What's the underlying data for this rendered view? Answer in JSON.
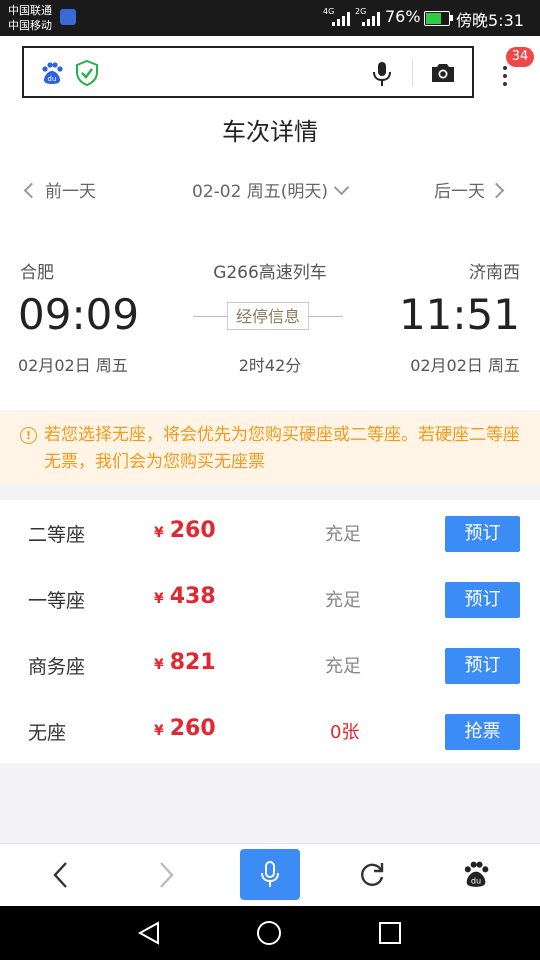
{
  "status_bar": {
    "carrier1": "中国联通",
    "carrier2": "中国移动",
    "net1": "4G",
    "net2": "2G",
    "battery": "76%",
    "battery_level": 0.76,
    "time": "傍晚5:31"
  },
  "browser": {
    "tab_count": "34"
  },
  "page": {
    "title": "车次详情",
    "prev_day": "前一天",
    "date": "02-02 周五(明天)",
    "next_day": "后一天"
  },
  "train": {
    "from": "合肥",
    "number": "G266高速列车",
    "to": "济南西",
    "dep_time": "09:09",
    "arr_time": "11:51",
    "stops_label": "经停信息",
    "dep_date": "02月02日 周五",
    "duration": "2时42分",
    "arr_date": "02月02日  周五"
  },
  "notice": {
    "text": "若您选择无座，将会优先为您购买硬座或二等座。若硬座二等座无票，我们会为您购买无座票"
  },
  "seats": [
    {
      "name": "二等座",
      "currency": "¥",
      "price": "260",
      "availability": "充足",
      "action": "预订"
    },
    {
      "name": "一等座",
      "currency": "¥",
      "price": "438",
      "availability": "充足",
      "action": "预订"
    },
    {
      "name": "商务座",
      "currency": "¥",
      "price": "821",
      "availability": "充足",
      "action": "预订"
    },
    {
      "name": "无座",
      "currency": "¥",
      "price": "260",
      "availability": "0张",
      "action": "抢票"
    }
  ],
  "colors": {
    "accent": "#3b8cf5",
    "price": "#e3262f",
    "notice": "#f29a1a"
  },
  "icons": {
    "baidu": "baidu-logo-icon",
    "shield": "shield-check-icon",
    "mic": "microphone-icon",
    "camera": "camera-icon",
    "menu": "more-vertical-icon",
    "back": "back-arrow-icon",
    "forward": "forward-arrow-icon",
    "refresh": "refresh-icon",
    "paw": "baidu-paw-icon"
  }
}
